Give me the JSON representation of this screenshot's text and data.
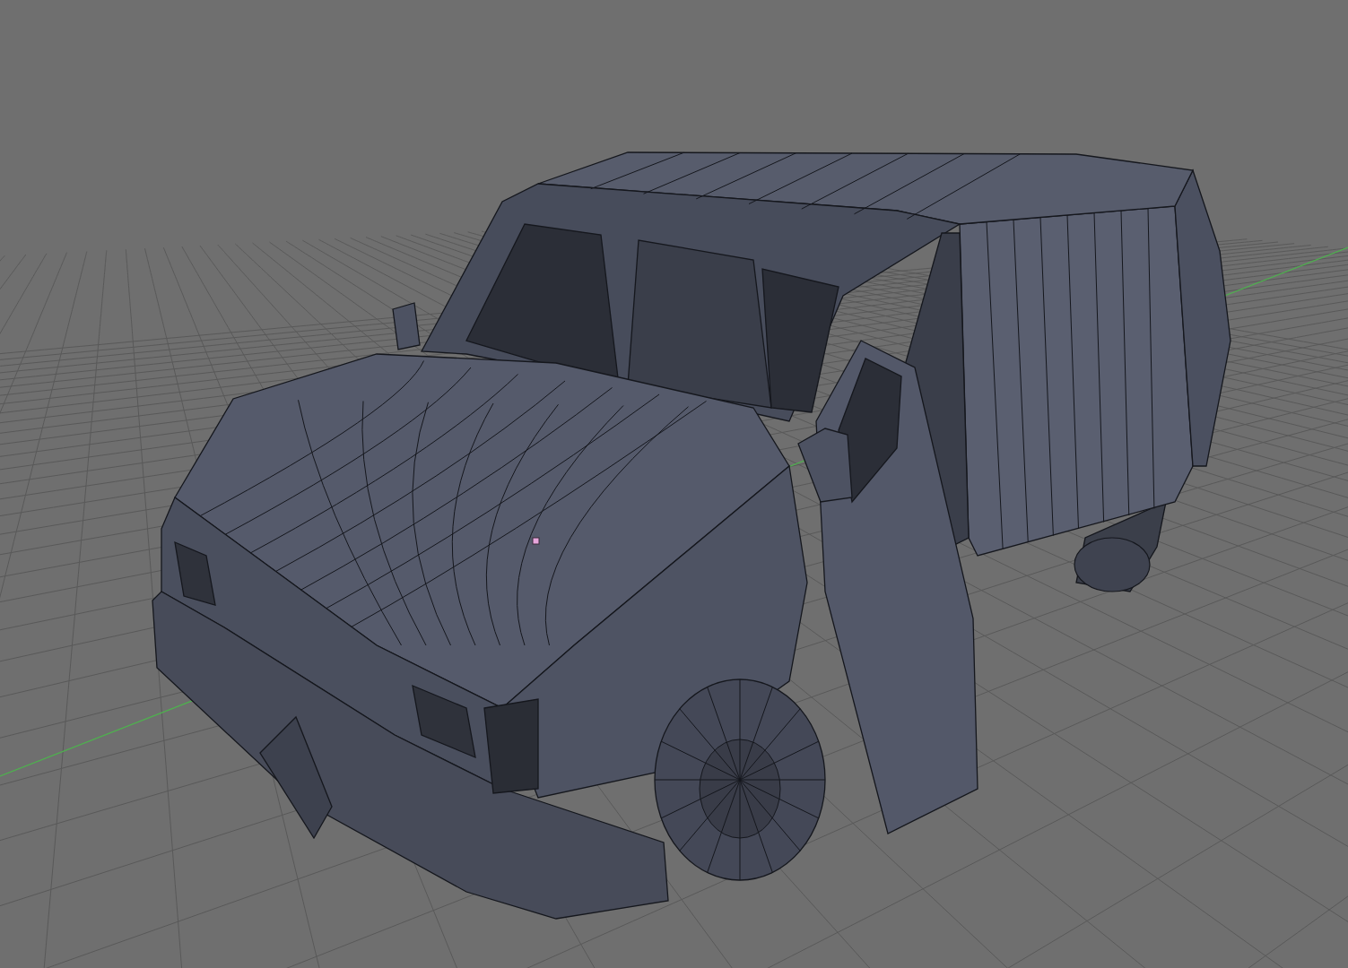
{
  "viewport": {
    "grid_shown": true,
    "x_axis_shown": true,
    "model": {
      "kind": "van",
      "wire_edges": true,
      "origin_dot": true
    }
  }
}
